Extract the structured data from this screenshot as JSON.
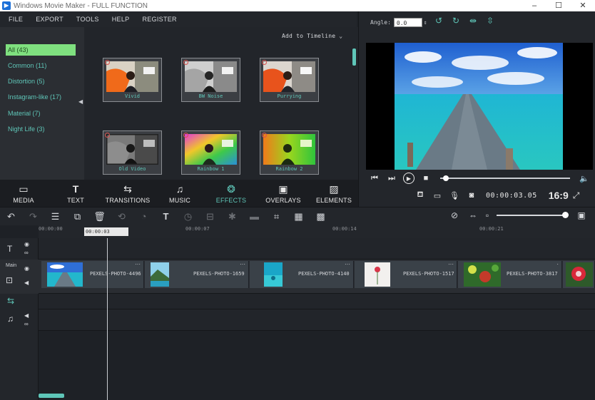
{
  "window": {
    "title": "Windows Movie Maker - FULL FUNCTION",
    "controls": [
      "–",
      "☐",
      "✕"
    ]
  },
  "menu": [
    "FILE",
    "EXPORT",
    "TOOLS",
    "HELP",
    "REGISTER"
  ],
  "effects": {
    "categories": [
      {
        "label": "All (43)",
        "active": true
      },
      {
        "label": "Common (11)"
      },
      {
        "label": "Distortion (5)"
      },
      {
        "label": "Instagram-like (17)"
      },
      {
        "label": "Material (7)"
      },
      {
        "label": "Night Life (3)"
      }
    ],
    "add_to_timeline": "Add to Timeline",
    "cards": [
      {
        "label": "Vivid"
      },
      {
        "label": "BW Noise"
      },
      {
        "label": "Purrying"
      },
      {
        "label": "Old Video"
      },
      {
        "label": "Rainbow 1"
      },
      {
        "label": "Rainbow 2"
      }
    ]
  },
  "preview": {
    "angle_label": "Angle:",
    "angle_value": "0.0",
    "timecode": "00:00:03.05",
    "aspect_ratio": "16:9"
  },
  "tabs": [
    {
      "label": "MEDIA",
      "icon": "folder-icon"
    },
    {
      "label": "TEXT",
      "icon": "text-icon"
    },
    {
      "label": "TRANSITIONS",
      "icon": "transitions-icon"
    },
    {
      "label": "MUSIC",
      "icon": "music-icon"
    },
    {
      "label": "EFFECTS",
      "icon": "effects-icon",
      "active": true
    },
    {
      "label": "OVERLAYS",
      "icon": "overlays-icon"
    },
    {
      "label": "ELEMENTS",
      "icon": "elements-icon"
    }
  ],
  "timeline": {
    "ruler_ticks": [
      "00:00:00",
      "00:00:07",
      "00:00:14",
      "00:00:21"
    ],
    "playhead_time": "00:00:03",
    "main_label": "Main",
    "clips": [
      {
        "name": "PEXELS-PHOTO-4496"
      },
      {
        "name": "PEXELS-PHOTO-1659"
      },
      {
        "name": "PEXELS-PHOTO-4140"
      },
      {
        "name": "PEXELS-PHOTO-1517"
      },
      {
        "name": "PEXELS-PHOTO-3817"
      }
    ],
    "clip_more": "···"
  },
  "colors": {
    "accent": "#5fc6b8",
    "active_category": "#7fe07f",
    "panel": "#2a2d32",
    "background": "#1e2126"
  }
}
